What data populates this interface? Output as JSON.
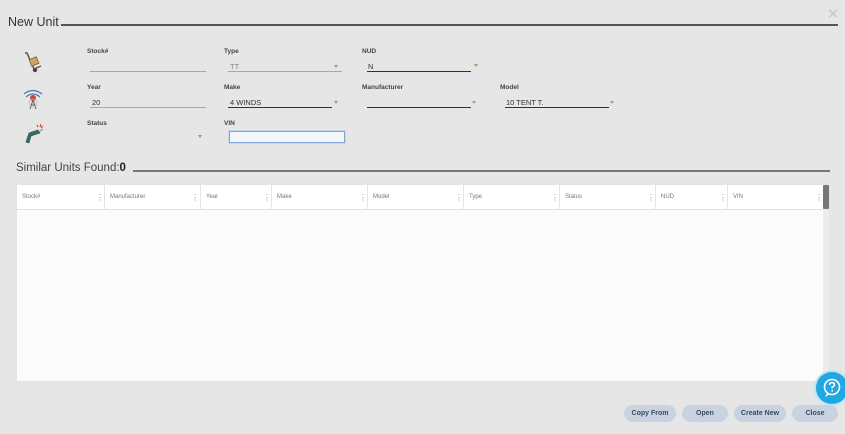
{
  "dialog": {
    "title": "New Unit",
    "close_glyph": "✕"
  },
  "icons": {
    "row1": "hand-truck-icon",
    "row2": "transmission-tower-icon",
    "row3": "drill-icon",
    "close": "close-icon",
    "help": "help-chat-icon",
    "column_menu": "vertical-dots-icon",
    "dropdown": "caret-down-icon"
  },
  "form": {
    "stock": {
      "label": "Stock#",
      "value": ""
    },
    "type": {
      "label": "Type",
      "value": "TT"
    },
    "nud": {
      "label": "NUD",
      "value": "N"
    },
    "year": {
      "label": "Year",
      "value": "20"
    },
    "make": {
      "label": "Make",
      "value": "4 WINDS"
    },
    "manufacturer": {
      "label": "Manufacturer",
      "value": ""
    },
    "model": {
      "label": "Model",
      "value": "10 TENT T."
    },
    "status": {
      "label": "Status",
      "value": ""
    },
    "vin": {
      "label": "VIN",
      "value": ""
    }
  },
  "similar": {
    "label": "Similar Units Found:",
    "count": "0"
  },
  "grid": {
    "columns": [
      {
        "label": "Stock#"
      },
      {
        "label": "Manufacturer"
      },
      {
        "label": "Year"
      },
      {
        "label": "Make"
      },
      {
        "label": "Model"
      },
      {
        "label": "Type"
      },
      {
        "label": "Status"
      },
      {
        "label": "NUD"
      },
      {
        "label": "VIN"
      }
    ],
    "rows": []
  },
  "buttons": {
    "copy_from": "Copy From",
    "open": "Open",
    "create_new": "Create New",
    "close": "Close"
  },
  "colors": {
    "accent": "#21a8e2",
    "button_bg": "#c8d3e0",
    "vin_focus": "#7fa4d6",
    "background": "#e6e6e6"
  }
}
